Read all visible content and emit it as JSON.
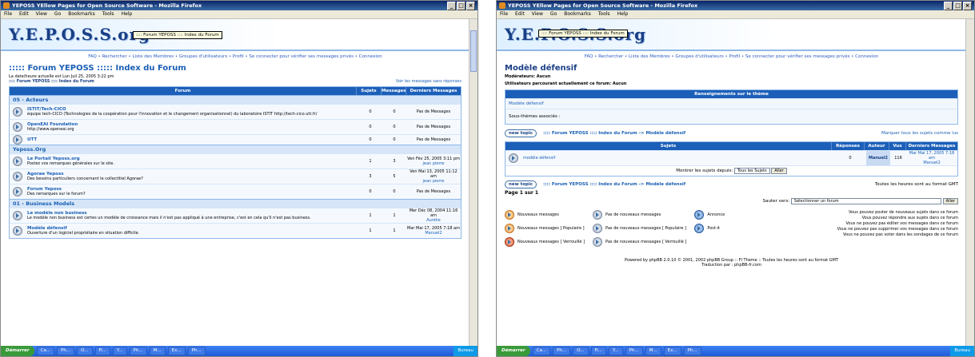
{
  "window_title": "YEPOSS YEllow Pages for Open Source Software - Mozilla Firefox",
  "menu": [
    "File",
    "Edit",
    "View",
    "Go",
    "Bookmarks",
    "Tools",
    "Help"
  ],
  "logo_text": "Y.E.P.O.S.S.org",
  "tooltip": ":::: Forum YEPOSS :::: Index du Forum",
  "navlinks": "FAQ • Rechercher • Liste des Membres • Groupes d'utilisateurs • Profil • Se connecter pour vérifier ses messages privés • Connexion",
  "taskbar": {
    "start": "Démarrer",
    "buttons": [
      "Ca...",
      "Ph...",
      "O...",
      "Fi...",
      "Y...",
      "Ph...",
      "M...",
      "Ex...",
      "Ph..."
    ],
    "tray": "Bureau"
  },
  "left": {
    "page_title": "::::: Forum YEPOSS ::::: Index du Forum",
    "datetime": "La date/heure actuelle est Lun Juil 25, 2005 3:22 pm",
    "breadcrumb": ":::: Forum YEPOSS :::: Index du Forum",
    "unanswered_link": "Voir les messages sans réponses",
    "headers": {
      "forum": "Forum",
      "sujets": "Sujets",
      "messages": "Messages",
      "derniers": "Derniers Messages"
    },
    "categories": [
      {
        "name": "05 - Acteurs",
        "forums": [
          {
            "name": "ISTIT/Tech-CICO",
            "desc": "équipe tech-CICO (Technologies de la coopération pour l'innovation et le changement organisationnel) du laboratoire ISTIT http://tech-cico.utt.fr/",
            "sujets": "0",
            "messages": "0",
            "last": "Pas de Messages",
            "last_user": ""
          },
          {
            "name": "OpenEAI Foundation",
            "desc": "http://www.openeai.org",
            "sujets": "0",
            "messages": "0",
            "last": "Pas de Messages",
            "last_user": ""
          },
          {
            "name": "UTT",
            "desc": "",
            "sujets": "0",
            "messages": "0",
            "last": "Pas de Messages",
            "last_user": ""
          }
        ]
      },
      {
        "name": "Yeposs.Org",
        "forums": [
          {
            "name": "Le Portail Yeposs.org",
            "desc": "Postez vos remarques générales sur le site.",
            "sujets": "1",
            "messages": "3",
            "last": "Ven Fév 25, 2005 3:11 pm",
            "last_user": "jean pierre"
          },
          {
            "name": "Agorae Yeposs",
            "desc": "Des besoins particuliers concernant le collectitiel Agorae?",
            "sujets": "3",
            "messages": "5",
            "last": "Ven Mai 13, 2005 11:12 am",
            "last_user": "jean pierre"
          },
          {
            "name": "Forum Yeposs",
            "desc": "Des remarques sur le forum?",
            "sujets": "0",
            "messages": "0",
            "last": "Pas de Messages",
            "last_user": ""
          }
        ]
      },
      {
        "name": "01 - Business Models",
        "forums": [
          {
            "name": "Le modèle non business",
            "desc": "Le modèle non business est certes un modèle de croissance mais il n'est pas appliqué à une entreprise, c'est en cela qu'il n'est pas business.",
            "sujets": "1",
            "messages": "1",
            "last": "Mer Déc 08, 2004 11:16 am",
            "last_user": "Aurélie"
          },
          {
            "name": "Modèle défensif",
            "desc": "Ouverture d'un logiciel propriétaire en situation difficile.",
            "sujets": "1",
            "messages": "1",
            "last": "Mar Mai 17, 2005 7:18 am",
            "last_user": "Manuel2"
          }
        ]
      }
    ]
  },
  "right": {
    "page_title": "Modèle défensif",
    "moderators": "Modérateurs: Aucun",
    "browsing": "Utilisateurs parcourant actuellement ce forum: Aucun",
    "info_header": "Renseignements sur le thème",
    "info_line1": "Modèle défensif",
    "info_line2": "Sous-thèmes associés :",
    "new_topic": "new topic",
    "path": ":::: Forum YEPOSS :::: Index du Forum -> Modèle défensif",
    "mark_read": "Marquer tous les sujets comme lus",
    "headers": {
      "sujets": "Sujets",
      "reponses": "Réponses",
      "auteur": "Auteur",
      "vus": "Vus",
      "derniers": "Derniers Messages"
    },
    "topic": {
      "name": "modèle défensif",
      "reponses": "0",
      "auteur": "Manuel2",
      "vus": "116",
      "last": "Mar Mai 17, 2005 7:18 am",
      "last_user": "Manuel2"
    },
    "show_since_label": "Montrer les sujets depuis:",
    "show_since_value": "Tous les Sujets",
    "go_label": "Aller",
    "timezone": "Toutes les heures sont au format GMT",
    "pagination": "Page 1 sur 1",
    "jump_label": "Sauter vers:",
    "jump_value": "Sélectionner un forum",
    "legend": [
      [
        "Nouveaux messages",
        "Nouveaux messages [ Populaire ]",
        "Nouveaux messages [ Verrouillé ]"
      ],
      [
        "Pas de nouveaux messages",
        "Pas de nouveaux messages [ Populaire ]",
        "Pas de nouveaux messages [ Verrouillé ]"
      ],
      [
        "Annonce",
        "Post-it"
      ]
    ],
    "permissions": [
      "Vous pouvez poster de nouveaux sujets dans ce forum",
      "Vous pouvez répondre aux sujets dans ce forum",
      "Vous ne pouvez pas éditer vos messages dans ce forum",
      "Vous ne pouvez pas supprimer vos messages dans ce forum",
      "Vous ne pouvez pas voter dans les sondages de ce forum"
    ],
    "footer1": "Powered by phpBB 2.0.10 © 2001, 2002 phpBB Group :: FI Theme :: Toutes les heures sont au format GMT",
    "footer2": "Traduction par : phpBB-fr.com"
  }
}
